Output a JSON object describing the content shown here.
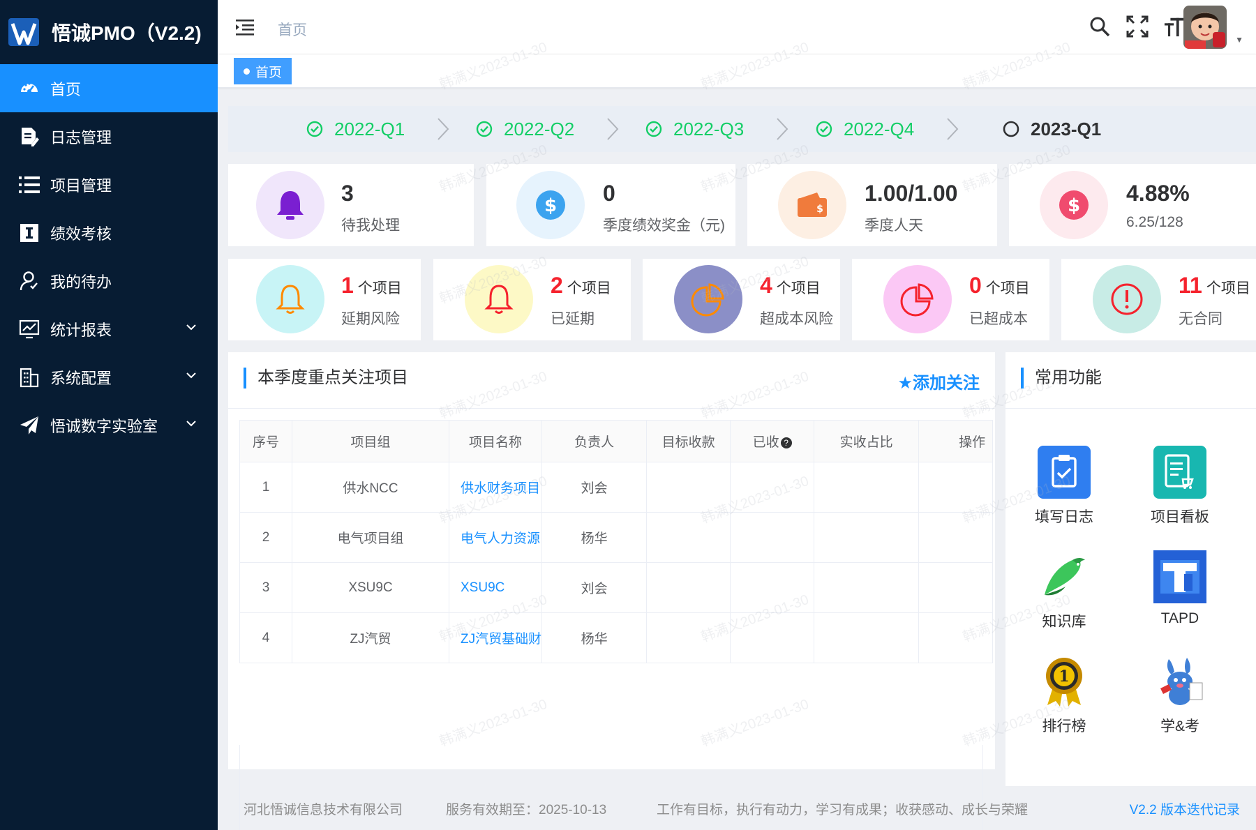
{
  "app": {
    "title": "悟诚PMO（V2.2)"
  },
  "sidebar": {
    "items": [
      {
        "label": "首页",
        "icon": "dashboard-icon",
        "active": true
      },
      {
        "label": "日志管理",
        "icon": "document-edit-icon"
      },
      {
        "label": "项目管理",
        "icon": "list-icon"
      },
      {
        "label": "绩效考核",
        "icon": "i-cursor-icon"
      },
      {
        "label": "我的待办",
        "icon": "user-todo-icon"
      },
      {
        "label": "统计报表",
        "icon": "chart-icon",
        "expandable": true
      },
      {
        "label": "系统配置",
        "icon": "building-icon",
        "expandable": true
      },
      {
        "label": "悟诚数字实验室",
        "icon": "paper-plane-icon",
        "expandable": true
      }
    ]
  },
  "header": {
    "breadcrumb": "首页",
    "icons": [
      "search-icon",
      "fullscreen-icon",
      "font-size-icon"
    ]
  },
  "tags": {
    "active": "首页"
  },
  "quarters": [
    {
      "label": "2022-Q1",
      "done": true
    },
    {
      "label": "2022-Q2",
      "done": true
    },
    {
      "label": "2022-Q3",
      "done": true
    },
    {
      "label": "2022-Q4",
      "done": true
    },
    {
      "label": "2023-Q1",
      "done": false
    }
  ],
  "stats": [
    {
      "value": "3",
      "label": "待我处理",
      "icon": "bell-icon",
      "color": "#7a1fd1",
      "bg": "#f0e6fb"
    },
    {
      "value": "0",
      "label": "季度绩效奖金（元)",
      "icon": "dollar-icon",
      "color": "#3ba3ef",
      "bg": "#e6f3fd"
    },
    {
      "value": "1.00/1.00",
      "label": "季度人天",
      "icon": "wallet-icon",
      "color": "#f07b3c",
      "bg": "#fdefe3"
    },
    {
      "value": "4.88%",
      "label": "6.25/128",
      "icon": "dollar-icon",
      "color": "#f04b6e",
      "bg": "#fdeaee"
    }
  ],
  "risks": [
    {
      "count": "1",
      "unit": "个项目",
      "label": "延期风险",
      "icon": "bell-outline-icon",
      "color": "#ff8a00",
      "bg": "#c8f4f6"
    },
    {
      "count": "2",
      "unit": "个项目",
      "label": "已延期",
      "icon": "bell-outline-icon",
      "color": "#f5222d",
      "bg": "#fdf9c6"
    },
    {
      "count": "4",
      "unit": "个项目",
      "label": "超成本风险",
      "icon": "pie-icon",
      "color": "#ff8a00",
      "bg": "#8b8fc7"
    },
    {
      "count": "0",
      "unit": "个项目",
      "label": "已超成本",
      "icon": "pie-icon",
      "color": "#f5222d",
      "bg": "#fbc8f5"
    },
    {
      "count": "11",
      "unit": "个项目",
      "label": "无合同",
      "icon": "alert-icon",
      "color": "#f5222d",
      "bg": "#c8ece6"
    }
  ],
  "focus": {
    "title": "本季度重点关注项目",
    "add_label": "★添加关注",
    "columns": [
      "序号",
      "项目组",
      "项目名称",
      "负责人",
      "目标收款",
      "已收",
      "实收占比",
      "操作"
    ],
    "rows": [
      {
        "no": "1",
        "group": "供水NCC",
        "name": "供水财务项目",
        "owner": "刘会"
      },
      {
        "no": "2",
        "group": "电气项目组",
        "name": "电气人力资源",
        "owner": "杨华"
      },
      {
        "no": "3",
        "group": "XSU9C",
        "name": "XSU9C",
        "owner": "刘会"
      },
      {
        "no": "4",
        "group": "ZJ汽贸",
        "name": "ZJ汽贸基础财",
        "owner": "杨华"
      }
    ]
  },
  "functions": {
    "title": "常用功能",
    "items": [
      {
        "label": "填写日志",
        "icon": "clipboard-check-icon",
        "color": "#2f7ef0"
      },
      {
        "label": "项目看板",
        "icon": "board-icon",
        "color": "#18b7b0"
      },
      {
        "label": "知识库",
        "icon": "bird-icon",
        "color": "#3cc65b"
      },
      {
        "label": "TAPD",
        "icon": "tapd-icon",
        "color": "#2461d6"
      },
      {
        "label": "排行榜",
        "icon": "medal-icon",
        "color": "#e2b100"
      },
      {
        "label": "学&考",
        "icon": "rabbit-icon",
        "color": "#3f7fd6"
      }
    ]
  },
  "footer": {
    "company": "河北悟诚信息技术有限公司",
    "validity": "服务有效期至：2025-10-13",
    "motto": "工作有目标，执行有动力，学习有成果；收获感动、成长与荣耀",
    "version": "V2.2 版本迭代记录"
  },
  "watermark": "韩满义2023-01-30"
}
